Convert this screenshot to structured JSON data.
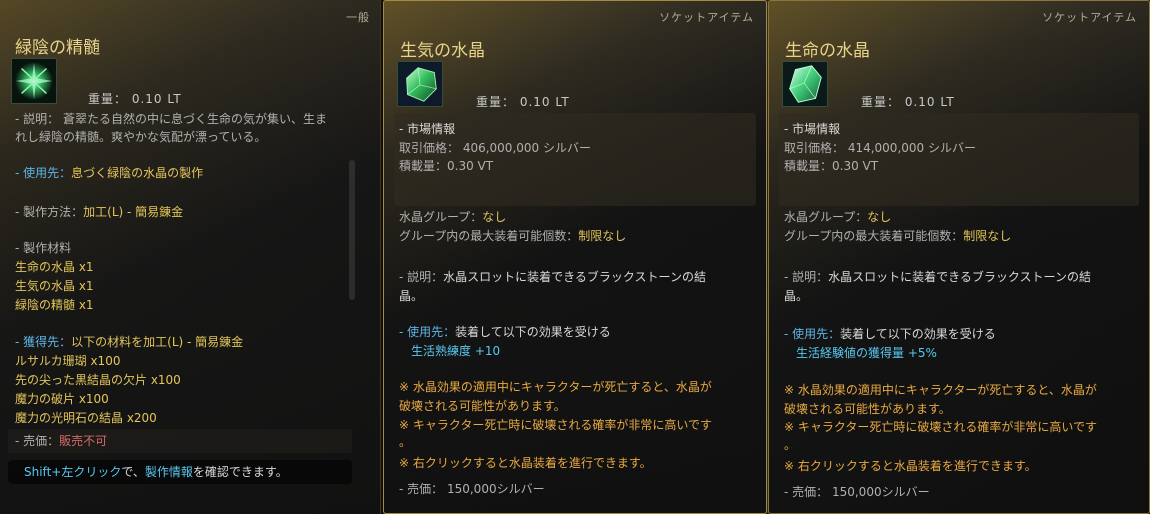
{
  "panels": [
    {
      "category": "一般",
      "title": "緑陰の精髄",
      "icon": "green-essence-icon",
      "weight": "重量：  0.10 LT",
      "desc1": "- 説明： 蒼翠たる自然の中に息づく生命の気が集い、生ま",
      "desc2": "れし緑陰の精髄。爽やかな気配が漂っている。",
      "use_prefix": "- 使用先：",
      "use_value": "息づく緑陰の水晶の製作",
      "method_prefix": "- 製作方法：",
      "method_value": "加工(L) - 簡易錬金",
      "materials_heading": "- 製作材料",
      "materials": [
        "生命の水晶 x1",
        "生気の水晶 x1",
        "緑陰の精髄 x1"
      ],
      "obtain_prefix": "- 獲得先：",
      "obtain_value": "以下の材料を加工(L) - 簡易錬金",
      "obtain_items": [
        "ルサルカ珊瑚 x100",
        "先の尖った黒結晶の欠片 x100",
        "魔力の破片 x100",
        "魔力の光明石の結晶 x200"
      ],
      "sale_prefix": "- 売価：",
      "sale_value": "販売不可",
      "shift_key": "Shift+左クリック",
      "shift_mid": "で、",
      "shift_link": "製作情報",
      "shift_tail": "を確認できます。"
    },
    {
      "category": "ソケットアイテム",
      "title": "生気の水晶",
      "icon": "green-crystal-icon",
      "weight": "重量：  0.10 LT",
      "market_heading": "- 市場情報",
      "price": "取引価格： 406,000,000 シルバー",
      "capacity": "積載量：0.30 VT",
      "group_label": "水晶グループ：",
      "group_value": "なし",
      "max_label": "グループ内の最大装着可能個数：",
      "max_value": "制限なし",
      "desc_prefix": "- 説明：",
      "desc_value": "水晶スロットに装着できるブラックストーンの結",
      "desc_cont": "晶。",
      "use_prefix": "- 使用先：",
      "use_value": "装着して以下の効果を受ける",
      "effect": "生活熟練度 +10",
      "note1": "※ 水晶効果の適用中にキャラクターが死亡すると、水晶が",
      "note2": "破壊される可能性があります。",
      "note3": "※ キャラクター死亡時に破壊される確率が非常に高いです",
      "note4": "。",
      "note5": "※ 右クリックすると水晶装着を進行できます。",
      "sale": "- 売価： 150,000シルバー"
    },
    {
      "category": "ソケットアイテム",
      "title": "生命の水晶",
      "icon": "green-crystal-icon",
      "weight": "重量：  0.10 LT",
      "market_heading": "- 市場情報",
      "price": "取引価格： 414,000,000 シルバー",
      "capacity": "積載量：0.30 VT",
      "group_label": "水晶グループ：",
      "group_value": "なし",
      "max_label": "グループ内の最大装着可能個数：",
      "max_value": "制限なし",
      "desc_prefix": "- 説明：",
      "desc_value": "水晶スロットに装着できるブラックストーンの結",
      "desc_cont": "晶。",
      "use_prefix": "- 使用先：",
      "use_value": "装着して以下の効果を受ける",
      "effect": "生活経験値の獲得量 +5%",
      "note1": "※ 水晶効果の適用中にキャラクターが死亡すると、水晶が",
      "note2": "破壊される可能性があります。",
      "note3": "※ キャラクター死亡時に破壊される確率が非常に高いです",
      "note4": "。",
      "note5": "※ 右クリックすると水晶装着を進行できます。",
      "sale": "- 売価： 150,000シルバー"
    }
  ]
}
